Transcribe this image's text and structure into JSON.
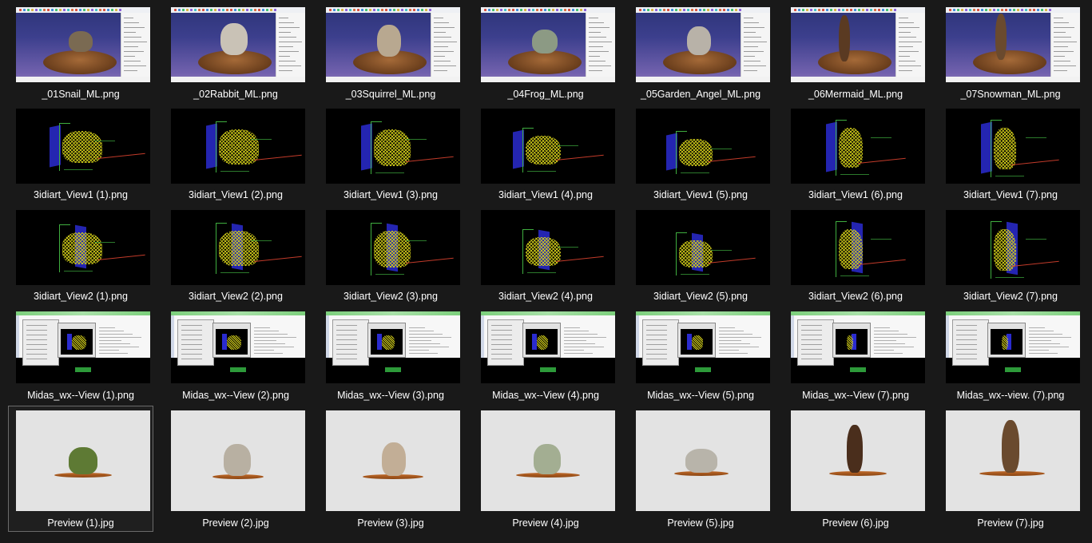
{
  "explorer": {
    "view": "extra-large-icons",
    "selected_item": "Preview (1).jpg",
    "rows": [
      {
        "group": "meshlab-screenshots",
        "items": [
          "_01Snail_ML.png",
          "_02Rabbit_ML.png",
          "_03Squirrel_ML.png",
          "_04Frog_ML.png",
          "_05Garden_Angel_ML.png",
          "_06Mermaid_ML.png",
          "_07Snowman_ML.png"
        ]
      },
      {
        "group": "wireframe-view-1",
        "items": [
          "3idiart_View1 (1).png",
          "3idiart_View1 (2).png",
          "3idiart_View1 (3).png",
          "3idiart_View1 (4).png",
          "3idiart_View1 (5).png",
          "3idiart_View1 (6).png",
          "3idiart_View1 (7).png"
        ]
      },
      {
        "group": "wireframe-view-2",
        "items": [
          "3idiart_View2 (1).png",
          "3idiart_View2 (2).png",
          "3idiart_View2 (3).png",
          "3idiart_View2 (4).png",
          "3idiart_View2 (5).png",
          "3idiart_View2 (6).png",
          "3idiart_View2 (7).png"
        ]
      },
      {
        "group": "midas-screenshots",
        "items": [
          "Midas_wx--View (1).png",
          "Midas_wx--View (2).png",
          "Midas_wx--View (3).png",
          "Midas_wx--View (4).png",
          "Midas_wx--View (5).png",
          "Midas_wx--View (7).png",
          "Midas_wx--view. (7).png"
        ]
      },
      {
        "group": "preview-photos",
        "items": [
          "Preview (1).jpg",
          "Preview (2).jpg",
          "Preview (3).jpg",
          "Preview (4).jpg",
          "Preview (5).jpg",
          "Preview (6).jpg",
          "Preview (7).jpg"
        ]
      }
    ]
  },
  "colors": {
    "background": "#191919",
    "label_text": "#ffffff",
    "selection_border": "#6b6b6b",
    "wire_mesh": "#d6d21a",
    "wire_wall": "#2a2bd0",
    "meshlab_bg_top": "#2d3478",
    "meshlab_bg_bottom": "#8c7ab8",
    "preview_bg": "#e3e3e3"
  }
}
